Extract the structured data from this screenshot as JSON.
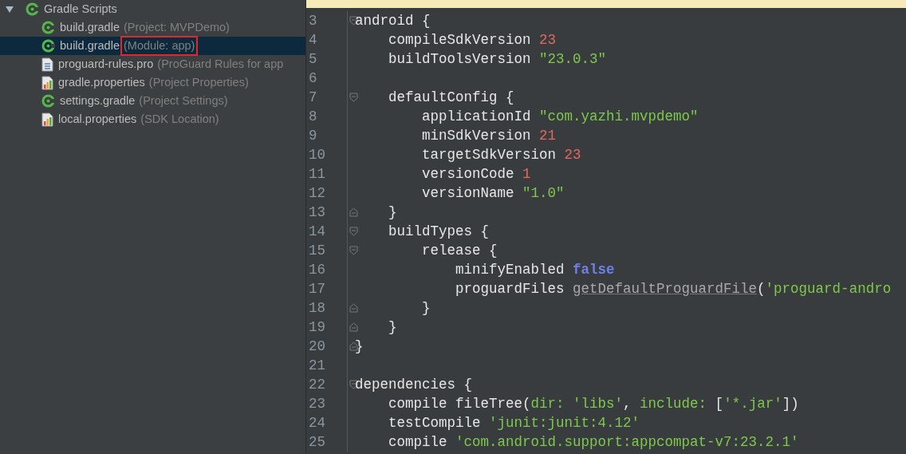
{
  "project_tree": {
    "root": {
      "label": "Gradle Scripts",
      "expanded": true,
      "kind": "gradle"
    },
    "items": [
      {
        "name": "build.gradle",
        "hint": "(Project: MVPDemo)",
        "kind": "gradle",
        "selected": false,
        "outlined": false
      },
      {
        "name": "build.gradle",
        "hint": "(Module: app)",
        "kind": "gradle",
        "selected": true,
        "outlined": true
      },
      {
        "name": "proguard-rules.pro",
        "hint": "(ProGuard Rules for app",
        "kind": "text",
        "selected": false,
        "outlined": false
      },
      {
        "name": "gradle.properties",
        "hint": "(Project Properties)",
        "kind": "properties",
        "selected": false,
        "outlined": false
      },
      {
        "name": "settings.gradle",
        "hint": "(Project Settings)",
        "kind": "gradle",
        "selected": false,
        "outlined": false
      },
      {
        "name": "local.properties",
        "hint": "(SDK Location)",
        "kind": "properties",
        "selected": false,
        "outlined": false
      }
    ]
  },
  "editor": {
    "lines": [
      {
        "number": "3",
        "kind": "fold-start",
        "tokens": [
          {
            "kind": "plain",
            "text": "android {"
          }
        ]
      },
      {
        "number": "4",
        "kind": "plain",
        "tokens": [
          {
            "kind": "plain",
            "text": "    compileSdkVersion "
          },
          {
            "kind": "number",
            "text": "23"
          }
        ]
      },
      {
        "number": "5",
        "kind": "plain",
        "tokens": [
          {
            "kind": "plain",
            "text": "    buildToolsVersion "
          },
          {
            "kind": "string",
            "text": "\"23.0.3\""
          }
        ]
      },
      {
        "number": "6",
        "kind": "plain"
      },
      {
        "number": "7",
        "kind": "fold-start",
        "tokens": [
          {
            "kind": "plain",
            "text": "    defaultConfig {"
          }
        ]
      },
      {
        "number": "8",
        "kind": "plain",
        "tokens": [
          {
            "kind": "plain",
            "text": "        applicationId "
          },
          {
            "kind": "string",
            "text": "\"com.yazhi.mvpdemo\""
          }
        ]
      },
      {
        "number": "9",
        "kind": "plain",
        "tokens": [
          {
            "kind": "plain",
            "text": "        minSdkVersion "
          },
          {
            "kind": "number",
            "text": "21"
          }
        ]
      },
      {
        "number": "10",
        "kind": "plain",
        "tokens": [
          {
            "kind": "plain",
            "text": "        targetSdkVersion "
          },
          {
            "kind": "number",
            "text": "23"
          }
        ]
      },
      {
        "number": "11",
        "kind": "plain",
        "tokens": [
          {
            "kind": "plain",
            "text": "        versionCode "
          },
          {
            "kind": "number",
            "text": "1"
          }
        ]
      },
      {
        "number": "12",
        "kind": "plain",
        "tokens": [
          {
            "kind": "plain",
            "text": "        versionName "
          },
          {
            "kind": "string",
            "text": "\"1.0\""
          }
        ]
      },
      {
        "number": "13",
        "kind": "fold-end",
        "tokens": [
          {
            "kind": "plain",
            "text": "    }"
          }
        ]
      },
      {
        "number": "14",
        "kind": "fold-start",
        "tokens": [
          {
            "kind": "plain",
            "text": "    buildTypes {"
          }
        ]
      },
      {
        "number": "15",
        "kind": "fold-start",
        "tokens": [
          {
            "kind": "plain",
            "text": "        release {"
          }
        ]
      },
      {
        "number": "16",
        "kind": "plain",
        "tokens": [
          {
            "kind": "plain",
            "text": "            minifyEnabled "
          },
          {
            "kind": "keyword",
            "text": "false"
          }
        ]
      },
      {
        "number": "17",
        "kind": "plain",
        "tokens": [
          {
            "kind": "plain",
            "text": "            proguardFiles "
          },
          {
            "kind": "method",
            "text": "getDefaultProguardFile"
          },
          {
            "kind": "plain",
            "text": "("
          },
          {
            "kind": "string",
            "text": "'proguard-andro"
          }
        ]
      },
      {
        "number": "18",
        "kind": "fold-end",
        "tokens": [
          {
            "kind": "plain",
            "text": "        }"
          }
        ]
      },
      {
        "number": "19",
        "kind": "fold-end",
        "tokens": [
          {
            "kind": "plain",
            "text": "    }"
          }
        ]
      },
      {
        "number": "20",
        "kind": "fold-end",
        "tokens": [
          {
            "kind": "plain",
            "text": "}"
          }
        ]
      },
      {
        "number": "21",
        "kind": "plain"
      },
      {
        "number": "22",
        "kind": "fold-start",
        "tokens": [
          {
            "kind": "plain",
            "text": "dependencies {"
          }
        ]
      },
      {
        "number": "23",
        "kind": "plain",
        "tokens": [
          {
            "kind": "plain",
            "text": "    compile fileTree("
          },
          {
            "kind": "param",
            "text": "dir: "
          },
          {
            "kind": "string",
            "text": "'libs'"
          },
          {
            "kind": "plain",
            "text": ", "
          },
          {
            "kind": "param",
            "text": "include: "
          },
          {
            "kind": "plain",
            "text": "["
          },
          {
            "kind": "string",
            "text": "'*.jar'"
          },
          {
            "kind": "plain",
            "text": "])"
          }
        ]
      },
      {
        "number": "24",
        "kind": "plain",
        "tokens": [
          {
            "kind": "plain",
            "text": "    testCompile "
          },
          {
            "kind": "string",
            "text": "'junit:junit:4.12'"
          }
        ]
      },
      {
        "number": "25",
        "kind": "plain",
        "tokens": [
          {
            "kind": "plain",
            "text": "    compile "
          },
          {
            "kind": "string",
            "text": "'com.android.support:appcompat-v7:23.2.1'"
          }
        ]
      }
    ]
  }
}
